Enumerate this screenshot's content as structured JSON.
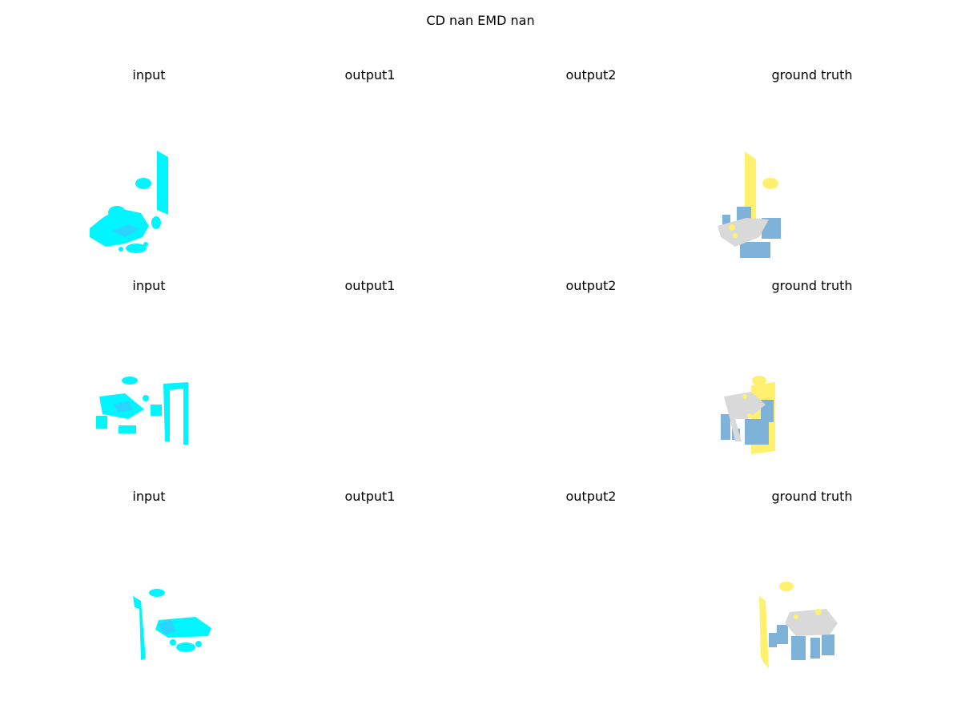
{
  "figure": {
    "title": "CD nan  EMD nan"
  },
  "colors": {
    "input_points": "#00f5ff",
    "input_points_shade": "#3fc4ff",
    "gt_table": "#d9d9d9",
    "gt_chairs": "#7fb2d8",
    "gt_wall": "#fff06e",
    "background": "#ffffff"
  },
  "rows": [
    {
      "panels": [
        {
          "title": "input",
          "content": "partial-point-cloud"
        },
        {
          "title": "output1",
          "content": "empty"
        },
        {
          "title": "output2",
          "content": "empty"
        },
        {
          "title": "ground truth",
          "content": "complete-point-cloud"
        }
      ]
    },
    {
      "panels": [
        {
          "title": "input",
          "content": "partial-point-cloud"
        },
        {
          "title": "output1",
          "content": "empty"
        },
        {
          "title": "output2",
          "content": "empty"
        },
        {
          "title": "ground truth",
          "content": "complete-point-cloud"
        }
      ]
    },
    {
      "panels": [
        {
          "title": "input",
          "content": "partial-point-cloud"
        },
        {
          "title": "output1",
          "content": "empty"
        },
        {
          "title": "output2",
          "content": "empty"
        },
        {
          "title": "ground truth",
          "content": "complete-point-cloud"
        }
      ]
    }
  ]
}
